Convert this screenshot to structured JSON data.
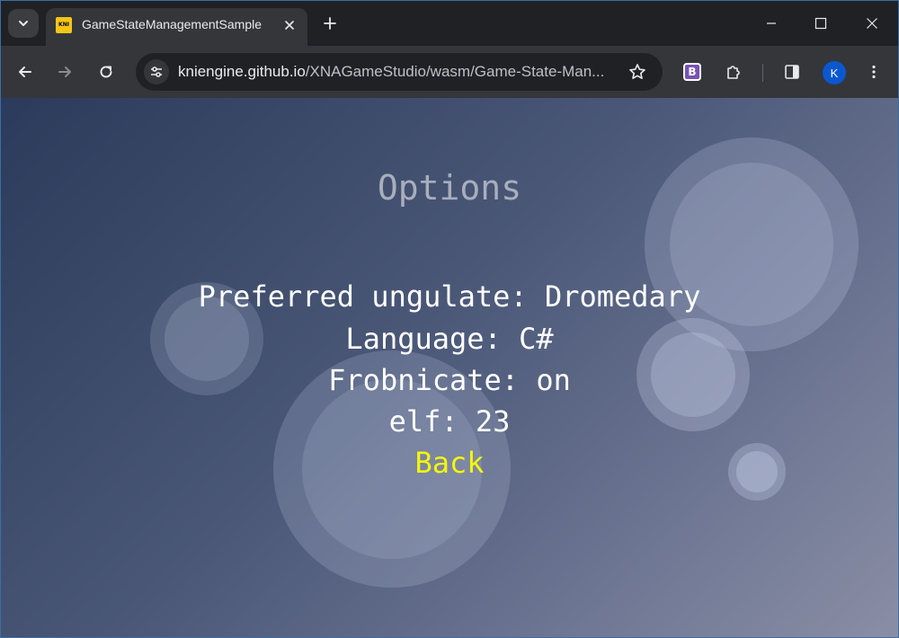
{
  "browser": {
    "tab": {
      "title": "GameStateManagementSample",
      "favicon_text": "KNI",
      "favicon_icon": "kni-logo-icon",
      "close_icon": "close-icon"
    },
    "new_tab_icon": "plus-icon",
    "window_controls": [
      "minimize-icon",
      "maximize-icon",
      "close-icon"
    ],
    "toolbar": {
      "back_icon": "arrow-left-icon",
      "forward_icon": "arrow-right-icon",
      "reload_icon": "reload-icon",
      "site_info_icon": "tune-icon",
      "url_host": "kniengine.github.io",
      "url_path": "/XNAGameStudio/wasm/Game-State-Man...",
      "bookmark_icon": "star-icon",
      "extension_b_label": "B",
      "extensions_icon": "puzzle-icon",
      "side_panel_icon": "side-panel-icon",
      "profile_initial": "K",
      "menu_icon": "kebab-menu-icon"
    }
  },
  "game": {
    "screen_title": "Options",
    "menu": [
      {
        "label": "Preferred ungulate: Dromedary",
        "selected": false
      },
      {
        "label": "Language: C#",
        "selected": false
      },
      {
        "label": "Frobnicate: on",
        "selected": false
      },
      {
        "label": "elf: 23",
        "selected": false
      },
      {
        "label": "Back",
        "selected": true
      }
    ],
    "colors": {
      "title": "#a9aebc",
      "item": "#ffffff",
      "selected_item": "#f5f50a"
    }
  }
}
